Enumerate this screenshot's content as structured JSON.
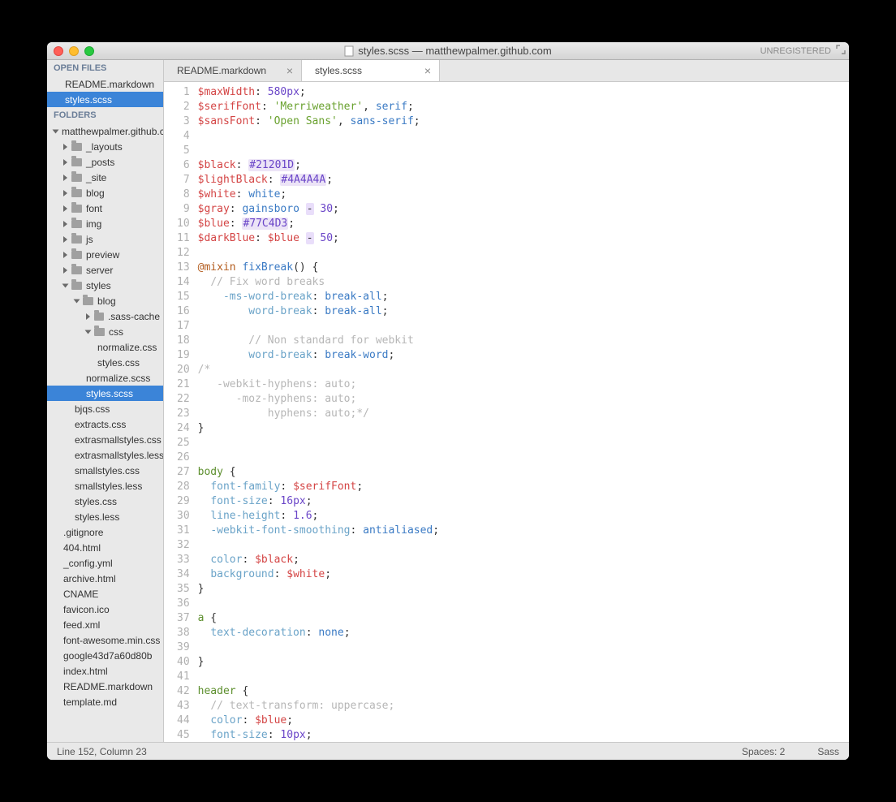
{
  "window_title": "styles.scss — matthewpalmer.github.com",
  "registered_label": "UNREGISTERED",
  "sidebar": {
    "open_files_label": "OPEN FILES",
    "folders_label": "FOLDERS",
    "open_files": [
      {
        "name": "README.markdown",
        "selected": false
      },
      {
        "name": "styles.scss",
        "selected": true
      }
    ],
    "root_folder": "matthewpalmer.github.c",
    "tree": [
      {
        "name": "_layouts",
        "type": "folder",
        "depth": 1
      },
      {
        "name": "_posts",
        "type": "folder",
        "depth": 1
      },
      {
        "name": "_site",
        "type": "folder",
        "depth": 1
      },
      {
        "name": "blog",
        "type": "folder",
        "depth": 1
      },
      {
        "name": "font",
        "type": "folder",
        "depth": 1
      },
      {
        "name": "img",
        "type": "folder",
        "depth": 1
      },
      {
        "name": "js",
        "type": "folder",
        "depth": 1
      },
      {
        "name": "preview",
        "type": "folder",
        "depth": 1
      },
      {
        "name": "server",
        "type": "folder",
        "depth": 1
      },
      {
        "name": "styles",
        "type": "folder",
        "depth": 1,
        "open": true
      },
      {
        "name": "blog",
        "type": "folder",
        "depth": 2,
        "open": true
      },
      {
        "name": ".sass-cache",
        "type": "folder",
        "depth": 3
      },
      {
        "name": "css",
        "type": "folder",
        "depth": 3,
        "open": true
      },
      {
        "name": "normalize.css",
        "type": "file",
        "depth": 4
      },
      {
        "name": "styles.css",
        "type": "file",
        "depth": 4
      },
      {
        "name": "normalize.scss",
        "type": "file",
        "depth": 3
      },
      {
        "name": "styles.scss",
        "type": "file",
        "depth": 3,
        "selected": true
      },
      {
        "name": "bjqs.css",
        "type": "file",
        "depth": 2
      },
      {
        "name": "extracts.css",
        "type": "file",
        "depth": 2
      },
      {
        "name": "extrasmallstyles.css",
        "type": "file",
        "depth": 2
      },
      {
        "name": "extrasmallstyles.less",
        "type": "file",
        "depth": 2
      },
      {
        "name": "smallstyles.css",
        "type": "file",
        "depth": 2
      },
      {
        "name": "smallstyles.less",
        "type": "file",
        "depth": 2
      },
      {
        "name": "styles.css",
        "type": "file",
        "depth": 2
      },
      {
        "name": "styles.less",
        "type": "file",
        "depth": 2
      },
      {
        "name": ".gitignore",
        "type": "file",
        "depth": 1
      },
      {
        "name": "404.html",
        "type": "file",
        "depth": 1
      },
      {
        "name": "_config.yml",
        "type": "file",
        "depth": 1
      },
      {
        "name": "archive.html",
        "type": "file",
        "depth": 1
      },
      {
        "name": "CNAME",
        "type": "file",
        "depth": 1
      },
      {
        "name": "favicon.ico",
        "type": "file",
        "depth": 1
      },
      {
        "name": "feed.xml",
        "type": "file",
        "depth": 1
      },
      {
        "name": "font-awesome.min.css",
        "type": "file",
        "depth": 1
      },
      {
        "name": "google43d7a60d80b",
        "type": "file",
        "depth": 1
      },
      {
        "name": "index.html",
        "type": "file",
        "depth": 1
      },
      {
        "name": "README.markdown",
        "type": "file",
        "depth": 1
      },
      {
        "name": "template.md",
        "type": "file",
        "depth": 1
      }
    ]
  },
  "tabs": [
    {
      "label": "README.markdown",
      "active": false
    },
    {
      "label": "styles.scss",
      "active": true
    }
  ],
  "status": {
    "pos": "Line 152, Column 23",
    "spaces": "Spaces: 2",
    "syntax": "Sass"
  },
  "code": [
    [
      [
        "var",
        "$maxWidth"
      ],
      [
        "punc",
        ": "
      ],
      [
        "num",
        "580px"
      ],
      [
        "punc",
        ";"
      ]
    ],
    [
      [
        "var",
        "$serifFont"
      ],
      [
        "punc",
        ": "
      ],
      [
        "str",
        "'Merriweather'"
      ],
      [
        "punc",
        ", "
      ],
      [
        "builtin",
        "serif"
      ],
      [
        "punc",
        ";"
      ]
    ],
    [
      [
        "var",
        "$sansFont"
      ],
      [
        "punc",
        ": "
      ],
      [
        "str",
        "'Open Sans'"
      ],
      [
        "punc",
        ", "
      ],
      [
        "builtin",
        "sans-serif"
      ],
      [
        "punc",
        ";"
      ]
    ],
    [],
    [],
    [
      [
        "var",
        "$black"
      ],
      [
        "punc",
        ": "
      ],
      [
        "color",
        "#21201D"
      ],
      [
        "punc",
        ";"
      ]
    ],
    [
      [
        "var",
        "$lightBlack"
      ],
      [
        "punc",
        ": "
      ],
      [
        "color",
        "#4A4A4A"
      ],
      [
        "punc",
        ";"
      ]
    ],
    [
      [
        "var",
        "$white"
      ],
      [
        "punc",
        ": "
      ],
      [
        "builtin",
        "white"
      ],
      [
        "punc",
        ";"
      ]
    ],
    [
      [
        "var",
        "$gray"
      ],
      [
        "punc",
        ": "
      ],
      [
        "builtin",
        "gainsboro"
      ],
      [
        "punc",
        " "
      ],
      [
        "op",
        "-"
      ],
      [
        "punc",
        " "
      ],
      [
        "num",
        "30"
      ],
      [
        "punc",
        ";"
      ]
    ],
    [
      [
        "var",
        "$blue"
      ],
      [
        "punc",
        ": "
      ],
      [
        "color",
        "#77C4D3"
      ],
      [
        "punc",
        ";"
      ]
    ],
    [
      [
        "var",
        "$darkBlue"
      ],
      [
        "punc",
        ": "
      ],
      [
        "var",
        "$blue"
      ],
      [
        "punc",
        " "
      ],
      [
        "op",
        "-"
      ],
      [
        "punc",
        " "
      ],
      [
        "num",
        "50"
      ],
      [
        "punc",
        ";"
      ]
    ],
    [],
    [
      [
        "kw",
        "@mixin"
      ],
      [
        "punc",
        " "
      ],
      [
        "kw2",
        "fixBreak"
      ],
      [
        "punc",
        "() {"
      ]
    ],
    [
      [
        "indent",
        "  "
      ],
      [
        "comm",
        "// Fix word breaks"
      ]
    ],
    [
      [
        "indent",
        "    "
      ],
      [
        "prop",
        "-ms-word-break"
      ],
      [
        "punc",
        ": "
      ],
      [
        "builtin",
        "break-all"
      ],
      [
        "punc",
        ";"
      ]
    ],
    [
      [
        "indent",
        "        "
      ],
      [
        "prop",
        "word-break"
      ],
      [
        "punc",
        ": "
      ],
      [
        "builtin",
        "break-all"
      ],
      [
        "punc",
        ";"
      ]
    ],
    [],
    [
      [
        "indent",
        "        "
      ],
      [
        "comm",
        "// Non standard for webkit"
      ]
    ],
    [
      [
        "indent",
        "        "
      ],
      [
        "prop",
        "word-break"
      ],
      [
        "punc",
        ": "
      ],
      [
        "builtin",
        "break-word"
      ],
      [
        "punc",
        ";"
      ]
    ],
    [
      [
        "comm",
        "/*"
      ]
    ],
    [
      [
        "indent",
        "   "
      ],
      [
        "comm",
        "-webkit-hyphens: auto;"
      ]
    ],
    [
      [
        "indent",
        "      "
      ],
      [
        "comm",
        "-moz-hyphens: auto;"
      ]
    ],
    [
      [
        "indent",
        "           "
      ],
      [
        "comm",
        "hyphens: auto;*/"
      ]
    ],
    [
      [
        "punc",
        "}"
      ]
    ],
    [],
    [],
    [
      [
        "sel",
        "body"
      ],
      [
        "punc",
        " {"
      ]
    ],
    [
      [
        "indent",
        "  "
      ],
      [
        "prop",
        "font-family"
      ],
      [
        "punc",
        ": "
      ],
      [
        "var",
        "$serifFont"
      ],
      [
        "punc",
        ";"
      ]
    ],
    [
      [
        "indent",
        "  "
      ],
      [
        "prop",
        "font-size"
      ],
      [
        "punc",
        ": "
      ],
      [
        "num",
        "16px"
      ],
      [
        "punc",
        ";"
      ]
    ],
    [
      [
        "indent",
        "  "
      ],
      [
        "prop",
        "line-height"
      ],
      [
        "punc",
        ": "
      ],
      [
        "num",
        "1.6"
      ],
      [
        "punc",
        ";"
      ]
    ],
    [
      [
        "indent",
        "  "
      ],
      [
        "prop",
        "-webkit-font-smoothing"
      ],
      [
        "punc",
        ": "
      ],
      [
        "builtin",
        "antialiased"
      ],
      [
        "punc",
        ";"
      ]
    ],
    [],
    [
      [
        "indent",
        "  "
      ],
      [
        "prop",
        "color"
      ],
      [
        "punc",
        ": "
      ],
      [
        "var",
        "$black"
      ],
      [
        "punc",
        ";"
      ]
    ],
    [
      [
        "indent",
        "  "
      ],
      [
        "prop",
        "background"
      ],
      [
        "punc",
        ": "
      ],
      [
        "var",
        "$white"
      ],
      [
        "punc",
        ";"
      ]
    ],
    [
      [
        "punc",
        "}"
      ]
    ],
    [],
    [
      [
        "sel",
        "a"
      ],
      [
        "punc",
        " {"
      ]
    ],
    [
      [
        "indent",
        "  "
      ],
      [
        "prop",
        "text-decoration"
      ],
      [
        "punc",
        ": "
      ],
      [
        "builtin",
        "none"
      ],
      [
        "punc",
        ";"
      ]
    ],
    [],
    [
      [
        "punc",
        "}"
      ]
    ],
    [],
    [
      [
        "sel",
        "header"
      ],
      [
        "punc",
        " {"
      ]
    ],
    [
      [
        "indent",
        "  "
      ],
      [
        "comm",
        "// text-transform: uppercase;"
      ]
    ],
    [
      [
        "indent",
        "  "
      ],
      [
        "prop",
        "color"
      ],
      [
        "punc",
        ": "
      ],
      [
        "var",
        "$blue"
      ],
      [
        "punc",
        ";"
      ]
    ],
    [
      [
        "indent",
        "  "
      ],
      [
        "prop",
        "font-size"
      ],
      [
        "punc",
        ": "
      ],
      [
        "num",
        "10px"
      ],
      [
        "punc",
        ";"
      ]
    ]
  ]
}
